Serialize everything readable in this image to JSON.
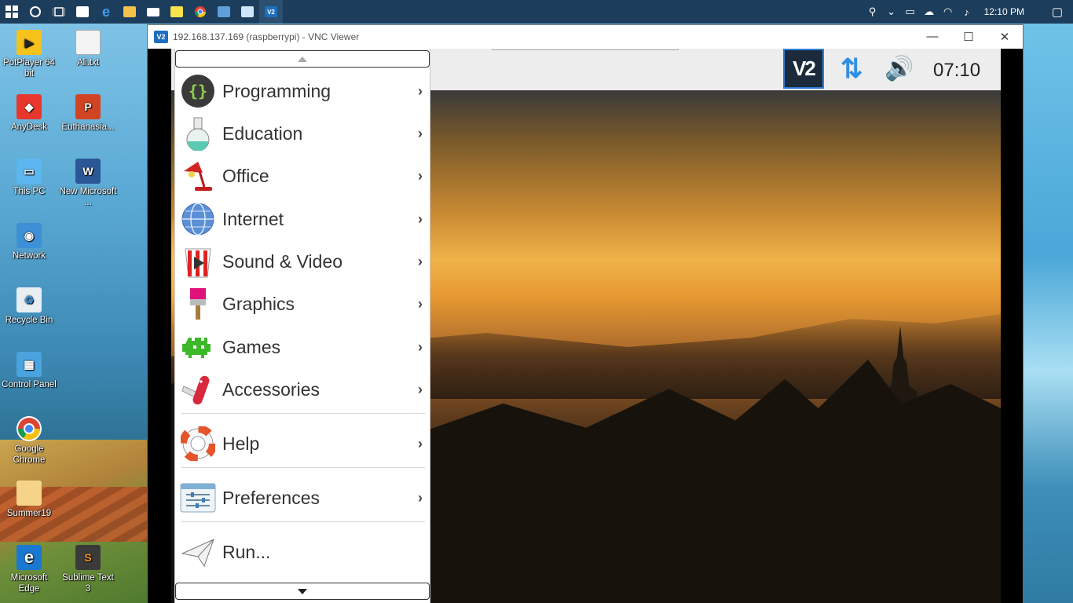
{
  "taskbar": {
    "clock": "12:10 PM"
  },
  "desktop": {
    "icons": [
      {
        "label": "PotPlayer 64 bit",
        "icon": "potplayer-icon"
      },
      {
        "label": "Ali.txt",
        "icon": "text-file-icon"
      },
      {
        "label": "AnyDesk",
        "icon": "anydesk-icon"
      },
      {
        "label": "Euthanasia...",
        "icon": "powerpoint-icon"
      },
      {
        "label": "This PC",
        "icon": "computer-icon"
      },
      {
        "label": "New Microsoft ...",
        "icon": "word-icon"
      },
      {
        "label": "Network",
        "icon": "network-icon"
      },
      {
        "label": "Recycle Bin",
        "icon": "recycle-bin-icon"
      },
      {
        "label": "Control Panel",
        "icon": "control-panel-icon"
      },
      {
        "label": "Google Chrome",
        "icon": "chrome-icon"
      },
      {
        "label": "Summer19",
        "icon": "folder-icon"
      },
      {
        "label": "Microsoft Edge",
        "icon": "edge-icon"
      },
      {
        "label": "Sublime Text 3",
        "icon": "sublime-icon"
      }
    ]
  },
  "vnc": {
    "title": "192.168.137.169 (raspberrypi) - VNC Viewer",
    "logo_text": "V2",
    "controls": {
      "minimize": "—",
      "maximize": "☐",
      "close": "✕"
    }
  },
  "pi": {
    "tray_vnc": "V2",
    "clock": "07:10",
    "menu": {
      "items": [
        {
          "label": "Programming",
          "icon": "programming-icon"
        },
        {
          "label": "Education",
          "icon": "education-flask-icon"
        },
        {
          "label": "Office",
          "icon": "office-lamp-icon"
        },
        {
          "label": "Internet",
          "icon": "internet-globe-icon"
        },
        {
          "label": "Sound & Video",
          "icon": "sound-video-icon"
        },
        {
          "label": "Graphics",
          "icon": "graphics-brush-icon"
        },
        {
          "label": "Games",
          "icon": "games-invader-icon"
        },
        {
          "label": "Accessories",
          "icon": "accessories-knife-icon"
        },
        {
          "label": "Help",
          "icon": "help-lifebuoy-icon"
        },
        {
          "label": "Preferences",
          "icon": "preferences-icon"
        },
        {
          "label": "Run...",
          "icon": "run-paperplane-icon"
        }
      ],
      "arrow": "›"
    }
  },
  "colors": {
    "taskbar": "#1d3d5c",
    "vnc_blue": "#1e6fc0",
    "pi_panel": "#ededed"
  }
}
